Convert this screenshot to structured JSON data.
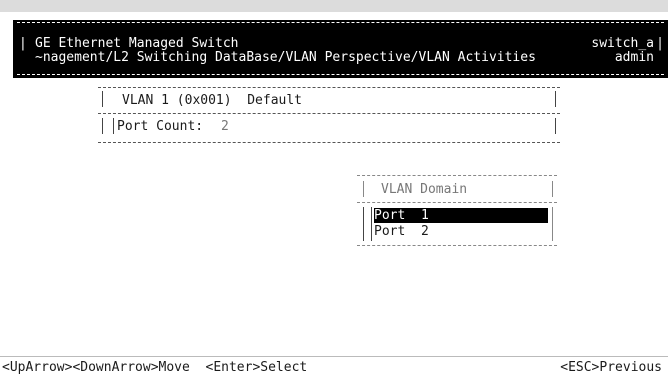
{
  "header": {
    "title": "GE Ethernet Managed Switch",
    "path": "~nagement/L2 Switching DataBase/VLAN Perspective/VLAN Activities",
    "hostname": "switch_a",
    "user": "admin"
  },
  "vlan_panel": {
    "vlan_label": "VLAN 1 (0x001)  Default",
    "port_count_label": "Port Count:",
    "port_count_value": "2"
  },
  "domain_panel": {
    "title": "VLAN Domain",
    "ports": [
      {
        "label": "Port  1",
        "selected": true
      },
      {
        "label": "Port  2",
        "selected": false
      }
    ]
  },
  "footer": {
    "left": "<UpArrow><DownArrow>Move  <Enter>Select",
    "right": "<ESC>Previous"
  },
  "colors": {
    "header_bg": "#000000",
    "header_fg": "#ffffff",
    "selection_bg": "#000000"
  }
}
